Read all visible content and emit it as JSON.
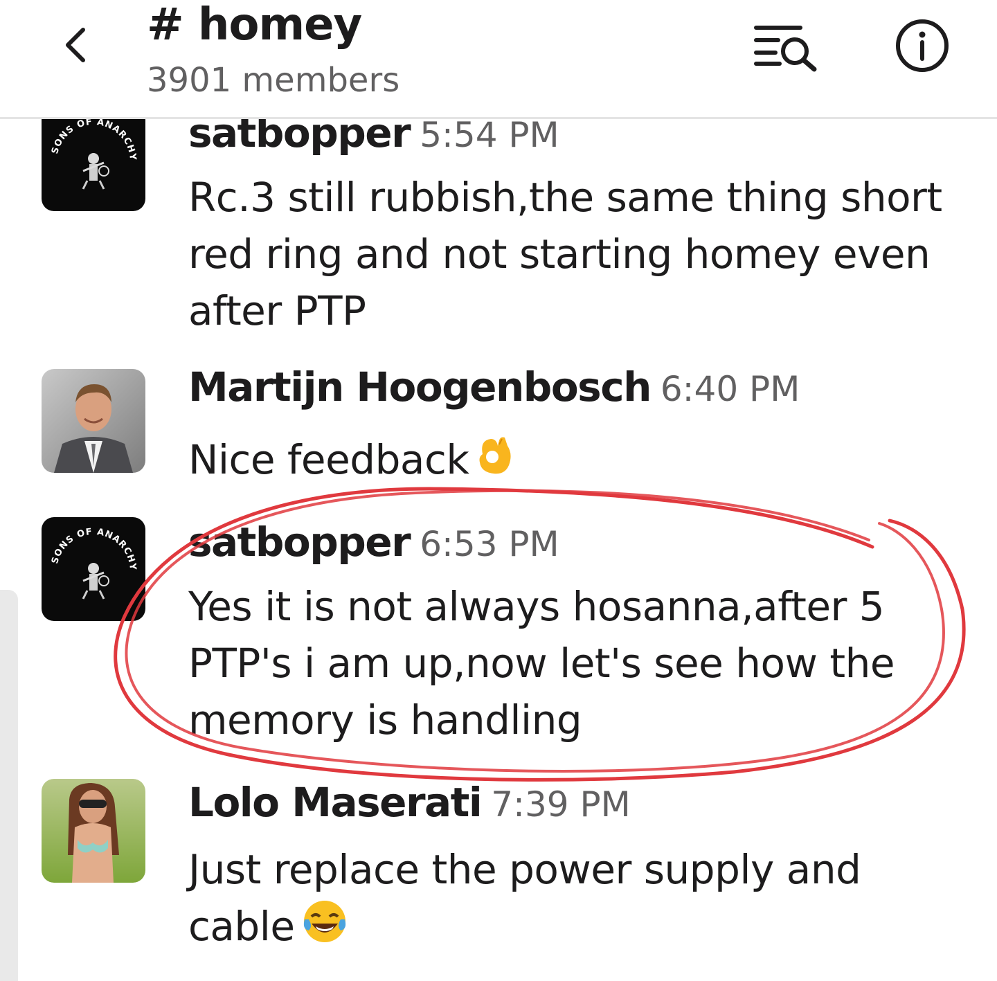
{
  "header": {
    "channel": "# homey",
    "members": "3901 members",
    "back_icon": "chevron-left-icon",
    "search_icon": "search-list-icon",
    "info_icon": "info-icon"
  },
  "messages": [
    {
      "author": "satbopper",
      "time": "5:54 PM",
      "text": "Rc.3 still rubbish,the same thing short red ring and not starting homey even after PTP",
      "avatar": "sons-of-anarchy-logo"
    },
    {
      "author": "Martijn Hoogenbosch",
      "time": "6:40 PM",
      "text": "Nice feedback",
      "emoji": "ok-hand-emoji",
      "avatar": "man-in-suit-photo"
    },
    {
      "author": "satbopper",
      "time": "6:53 PM",
      "text": "Yes it is not always hosanna,after 5 PTP's i am up,now let's see how the memory is handling",
      "avatar": "sons-of-anarchy-logo"
    },
    {
      "author": "Lolo Maserati",
      "time": "7:39 PM",
      "text": "Just replace the power supply and cable",
      "emoji": "tears-of-joy-emoji",
      "avatar": "woman-outdoors-photo"
    }
  ],
  "avatar_logo_text": "SONS OF ANARCHY",
  "colors": {
    "annotation": "#e0393e",
    "timestamp": "#616061",
    "text": "#1d1c1d",
    "divider": "#e4e4e4"
  }
}
